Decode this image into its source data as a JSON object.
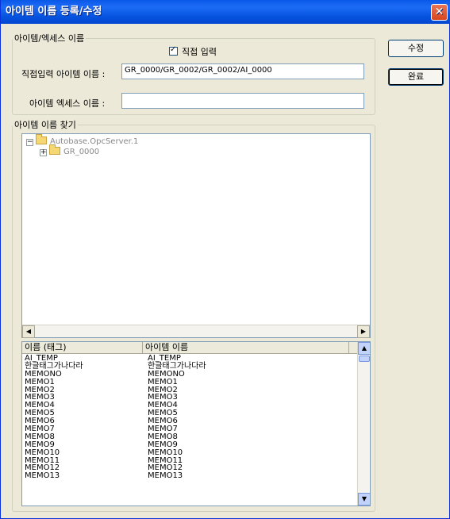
{
  "window": {
    "title": "아이템 이름 등록/수정",
    "close_glyph": "✕"
  },
  "buttons": {
    "modify": "수정",
    "done": "완료"
  },
  "group_item": {
    "legend": "아이템/엑세스 이름",
    "checkbox_label": "직접 입력",
    "direct_label": "직접입력 아이템 이름 :",
    "direct_value": "GR_0000/GR_0002/GR_0002/AI_0000",
    "access_label": "아이템 엑세스 이름 :",
    "access_value": ""
  },
  "group_find": {
    "legend": "아이템 이름 찾기",
    "tree": [
      {
        "expander": "−",
        "label": "Autobase.OpcServer.1"
      },
      {
        "expander": "+",
        "label": "GR_0000"
      }
    ],
    "list_columns": [
      "이름 (태그)",
      "아이템 이름"
    ],
    "list_rows": [
      [
        "AI_TEMP",
        "AI_TEMP"
      ],
      [
        "한글태그가나다라",
        "한글태그가나다라"
      ],
      [
        "MEMONO",
        "MEMONO"
      ],
      [
        "MEMO1",
        "MEMO1"
      ],
      [
        "MEMO2",
        "MEMO2"
      ],
      [
        "MEMO3",
        "MEMO3"
      ],
      [
        "MEMO4",
        "MEMO4"
      ],
      [
        "MEMO5",
        "MEMO5"
      ],
      [
        "MEMO6",
        "MEMO6"
      ],
      [
        "MEMO7",
        "MEMO7"
      ],
      [
        "MEMO8",
        "MEMO8"
      ],
      [
        "MEMO9",
        "MEMO9"
      ],
      [
        "MEMO10",
        "MEMO10"
      ],
      [
        "MEMO11",
        "MEMO11"
      ],
      [
        "MEMO12",
        "MEMO12"
      ],
      [
        "MEMO13",
        "MEMO13"
      ]
    ]
  }
}
